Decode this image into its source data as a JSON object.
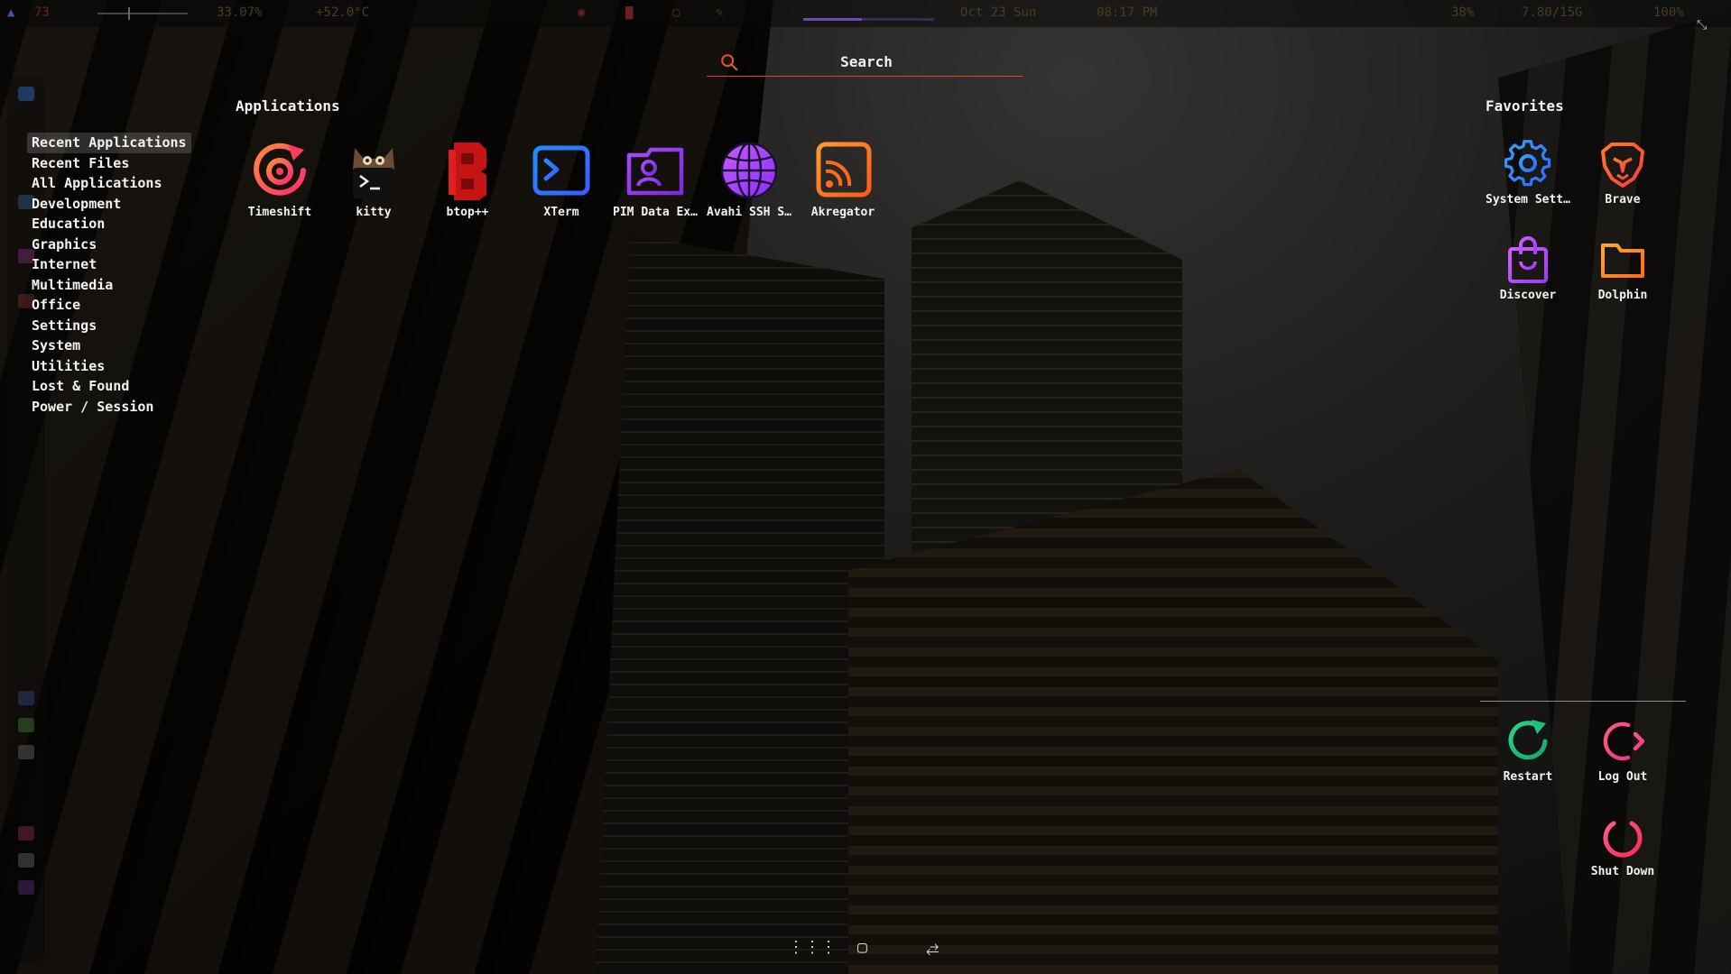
{
  "topbar": {
    "left_items": [
      "73",
      "33.07%",
      "+52.0°C"
    ],
    "date": "Oct 23 Sun",
    "time": "08:17 PM",
    "right_items": [
      "38%",
      "7.80/15G",
      "100%"
    ],
    "volume_level": 0.34,
    "media_progress": 0.45
  },
  "search": {
    "placeholder": "Search",
    "accent": "#c9521f"
  },
  "categories": [
    {
      "label": "Recent Applications",
      "selected": true
    },
    {
      "label": "Recent Files"
    },
    {
      "label": "All Applications"
    },
    {
      "label": "Development"
    },
    {
      "label": "Education"
    },
    {
      "label": "Graphics"
    },
    {
      "label": "Internet"
    },
    {
      "label": "Multimedia"
    },
    {
      "label": "Office"
    },
    {
      "label": "Settings"
    },
    {
      "label": "System"
    },
    {
      "label": "Utilities"
    },
    {
      "label": "Lost & Found"
    },
    {
      "label": "Power / Session"
    }
  ],
  "applications": {
    "title": "Applications",
    "items": [
      {
        "label": "Timeshift",
        "icon": "timeshift-icon"
      },
      {
        "label": "kitty",
        "icon": "kitty-icon"
      },
      {
        "label": "btop++",
        "icon": "btop-icon"
      },
      {
        "label": "XTerm",
        "icon": "terminal-icon"
      },
      {
        "label": "PIM Data Ex…",
        "icon": "contact-folder-icon"
      },
      {
        "label": "Avahi SSH S…",
        "icon": "globe-icon"
      },
      {
        "label": "Akregator",
        "icon": "rss-icon"
      }
    ]
  },
  "favorites": {
    "title": "Favorites",
    "items": [
      {
        "label": "System Sett…",
        "icon": "gear-icon"
      },
      {
        "label": "Brave",
        "icon": "brave-lion-icon"
      },
      {
        "label": "Discover",
        "icon": "shopping-bag-icon"
      },
      {
        "label": "Dolphin",
        "icon": "folder-icon"
      }
    ]
  },
  "session": {
    "items": [
      {
        "label": "Restart",
        "icon": "restart-icon"
      },
      {
        "label": "Log Out",
        "icon": "logout-icon"
      },
      {
        "label": "Shut Down",
        "icon": "power-icon"
      }
    ]
  },
  "bottom_bar": {
    "icons": [
      "grid-view-icon",
      "window-icon",
      "toggle-view-icon"
    ]
  }
}
